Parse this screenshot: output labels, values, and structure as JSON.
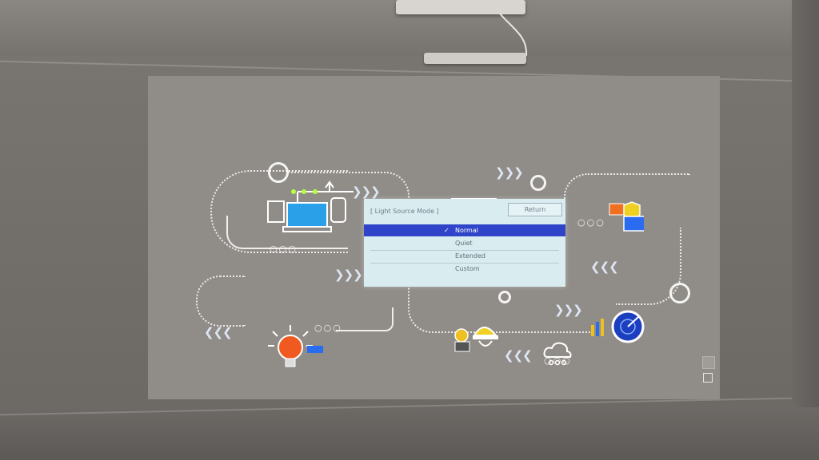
{
  "osd_menu": {
    "title": "[ Light Source Mode ]",
    "return_label": "Return",
    "items": [
      {
        "label": "Normal",
        "selected": true
      },
      {
        "label": "Quiet",
        "selected": false
      },
      {
        "label": "Extended",
        "selected": false
      },
      {
        "label": "Custom",
        "selected": false
      }
    ],
    "check_glyph": "✓",
    "selected_color": "#2f44c8"
  },
  "projected_graphics": {
    "icons": [
      "computer-network-icon",
      "security-shield-icon",
      "lightbulb-icon",
      "worker-helmet-icon",
      "cloud-icon",
      "radar-icon",
      "chart-magnifier-icon"
    ],
    "arrow_glyphs": {
      "right": "❯❯❯",
      "left": "❮❮❮"
    },
    "dot_glyph": "○○○"
  },
  "colors": {
    "wall": "#74706c",
    "screen": "#908c88",
    "osd_background": "#d9ecf0",
    "accent_yellow": "#f0e020",
    "accent_orange": "#f06a20",
    "accent_blue": "#2a6cf0"
  }
}
